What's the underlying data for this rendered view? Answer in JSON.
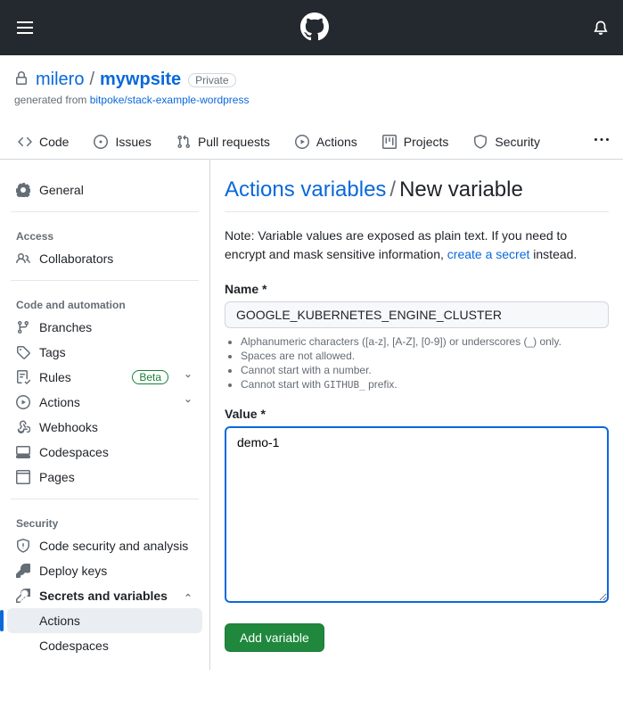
{
  "repo": {
    "owner": "milero",
    "name": "mywpsite",
    "visibility": "Private",
    "generated_prefix": "generated from ",
    "generated_link": "bitpoke/stack-example-wordpress"
  },
  "tabs": {
    "code": "Code",
    "issues": "Issues",
    "pull_requests": "Pull requests",
    "actions": "Actions",
    "projects": "Projects",
    "security": "Security"
  },
  "sidebar": {
    "general": "General",
    "group_access": "Access",
    "collaborators": "Collaborators",
    "group_code": "Code and automation",
    "branches": "Branches",
    "tags": "Tags",
    "rules": "Rules",
    "rules_badge": "Beta",
    "actions": "Actions",
    "webhooks": "Webhooks",
    "codespaces": "Codespaces",
    "pages": "Pages",
    "group_security": "Security",
    "code_security": "Code security and analysis",
    "deploy_keys": "Deploy keys",
    "secrets": "Secrets and variables",
    "sub_actions": "Actions",
    "sub_codespaces": "Codespaces"
  },
  "page": {
    "title_link": "Actions variables",
    "title_current": "New variable",
    "note_1": "Note: Variable values are exposed as plain text. If you need to encrypt and mask sensitive information, ",
    "note_link": "create a secret",
    "note_2": " instead.",
    "name_label": "Name *",
    "name_value": "GOOGLE_KUBERNETES_ENGINE_CLUSTER",
    "hint_1": "Alphanumeric characters ([a-z], [A-Z], [0-9]) or underscores (_) only.",
    "hint_2": "Spaces are not allowed.",
    "hint_3": "Cannot start with a number.",
    "hint_4_a": "Cannot start with ",
    "hint_4_code": "GITHUB_",
    "hint_4_b": " prefix.",
    "value_label": "Value *",
    "value_value": "demo-1",
    "add_button": "Add variable"
  }
}
